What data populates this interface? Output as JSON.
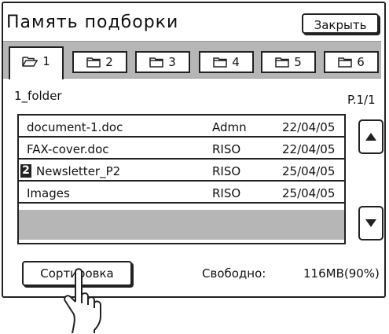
{
  "title": "Память подборки",
  "close_label": "Закрыть",
  "tabs": [
    {
      "label": "1",
      "active": true
    },
    {
      "label": "2",
      "active": false
    },
    {
      "label": "3",
      "active": false
    },
    {
      "label": "4",
      "active": false
    },
    {
      "label": "5",
      "active": false
    },
    {
      "label": "6",
      "active": false
    }
  ],
  "folder_name": "1_folder",
  "page_indicator": "P.1/1",
  "files": [
    {
      "badge": "",
      "name": "document-1.doc",
      "owner": "Admn",
      "date": "22/04/05"
    },
    {
      "badge": "",
      "name": "FAX-cover.doc",
      "owner": "RISO",
      "date": "22/04/05"
    },
    {
      "badge": "2",
      "name": "Newsletter_P2",
      "owner": "RISO",
      "date": "25/04/05"
    },
    {
      "badge": "",
      "name": "Images",
      "owner": "RISO",
      "date": "25/04/05"
    }
  ],
  "sort_label": "Сортировка",
  "free_label": "Свободно:",
  "free_value": "116MB(90%)",
  "icons": [
    "folder-open-icon",
    "folder-icon",
    "scroll-up-icon",
    "scroll-down-icon",
    "pointing-hand-icon"
  ],
  "colors": {
    "border": "#222222",
    "tab_bar": "#b6b6b6",
    "empty_row": "#b6b6b6"
  }
}
